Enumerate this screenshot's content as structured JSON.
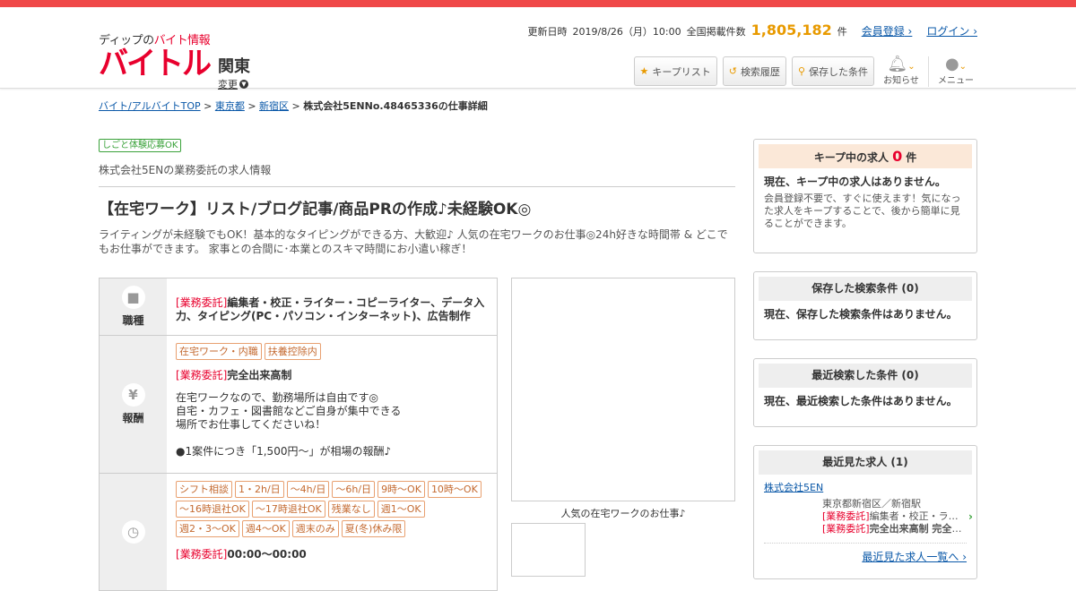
{
  "header": {
    "logo_sub_pre": "ディップの",
    "logo_sub_red": "バイト情報",
    "logo_main": "バイトル",
    "region": "関東",
    "region_change": "変更",
    "updated_label": "更新日時",
    "updated_value": "2019/8/26（月）10:00",
    "total_label": "全国掲載件数",
    "total_count": "1,805,182",
    "total_unit": "件",
    "register": "会員登録",
    "login": "ログイン",
    "keep_list": "キープリスト",
    "search_history": "検索履歴",
    "saved_conditions": "保存した条件",
    "notifications": "お知らせ",
    "menu": "メニュー"
  },
  "breadcrumb": {
    "top": "バイト/アルバイトTOP",
    "pref": "東京都",
    "ward": "新宿区",
    "current": "株式会社5ENNo.48465336の仕事詳細"
  },
  "job": {
    "badge": "しごと体験応募OK",
    "company": "株式会社5ENの業務委託の求人情報",
    "title": "【在宅ワーク】リスト/ブログ記事/商品PRの作成♪未経験OK◎",
    "description": "ライティングが未経験でもOK！基本的なタイピングができる方、大歓迎♪ 人気の在宅ワークのお仕事◎24h好きな時間帯 & どこでもお仕事ができます。 家事との合間に･本業とのスキマ時間にお小遣い稼ぎ！",
    "type_tag": "[業務委託]",
    "occupation_label": "職種",
    "occupation": "編集者・校正・ライター・コピーライター、データ入力、タイピング(PC・パソコン・インターネット)、広告制作",
    "pay_label": "報酬",
    "pay_chips": [
      "在宅ワーク・内職",
      "扶養控除内"
    ],
    "pay_title": "完全出来高制",
    "pay_lines": [
      "在宅ワークなので、勤務場所は自由です◎",
      "自宅・カフェ・図書館などご自身が集中できる",
      "場所でお仕事してくださいね！"
    ],
    "pay_note": "●1案件につき「1,500円～」が相場の報酬♪",
    "time_chips": [
      "シフト相談",
      "1・2h/日",
      "～4h/日",
      "～6h/日",
      "9時～OK",
      "10時～OK",
      "～16時退社OK",
      "～17時退社OK",
      "残業なし",
      "週1〜OK",
      "週2・3〜OK",
      "週4〜OK",
      "週末のみ",
      "夏(冬)休み限"
    ],
    "time_value": "00:00～00:00",
    "media_caption": "人気の在宅ワークのお仕事♪"
  },
  "sidebar": {
    "keep_title": "キープ中の求人",
    "keep_count": "0",
    "keep_unit": "件",
    "keep_empty": "現在、キープ中の求人はありません。",
    "keep_note": "会員登録不要で、すぐに使えます！気になった求人をキープすることで、後から簡単に見ることができます。",
    "saved_title": "保存した検索条件 (0)",
    "saved_empty": "現在、保存した検索条件はありません。",
    "recent_search_title": "最近検索した条件 (0)",
    "recent_search_empty": "現在、最近検索した条件はありません。",
    "recent_view_title": "最近見た求人 (1)",
    "recent_company": "株式会社5EN",
    "recent_location": "東京都新宿区／新宿駅",
    "recent_type": "[業務委託]",
    "recent_occupation": "編集者・校正・ライター・コピーライター",
    "recent_pay": "完全出来高制 完全出来高制",
    "recent_more": "最近見た求人一覧へ"
  },
  "colors": {
    "accent_red": "#e8002d",
    "link_blue": "#0a58a8",
    "count_orange": "#e89a00"
  }
}
